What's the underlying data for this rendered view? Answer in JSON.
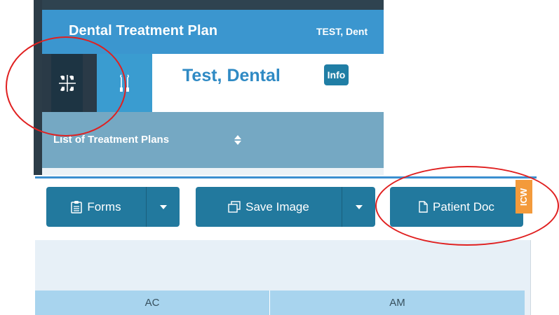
{
  "app": {
    "title": "Dental Treatment Plan",
    "patient_short": "TEST, Dent"
  },
  "toolbar_icons": [
    {
      "icon": "teeth-grid-icon",
      "selected": true
    },
    {
      "icon": "dental-tools-icon",
      "selected": false
    }
  ],
  "patient": {
    "name": "Test, Dental",
    "info_label": "Info"
  },
  "plans": {
    "label": "List of Treatment Plans",
    "sort_icon": "sort-icon"
  },
  "buttons": {
    "forms_label": "Forms",
    "save_image_label": "Save Image",
    "patient_doc_label": "Patient Doc",
    "icw_label": "ICW"
  },
  "table": {
    "headers": [
      "AC",
      "AM"
    ]
  },
  "colors": {
    "accent": "#3b96cf",
    "button": "#22799e",
    "annotation": "#e02020",
    "tag": "#f39a3b"
  }
}
